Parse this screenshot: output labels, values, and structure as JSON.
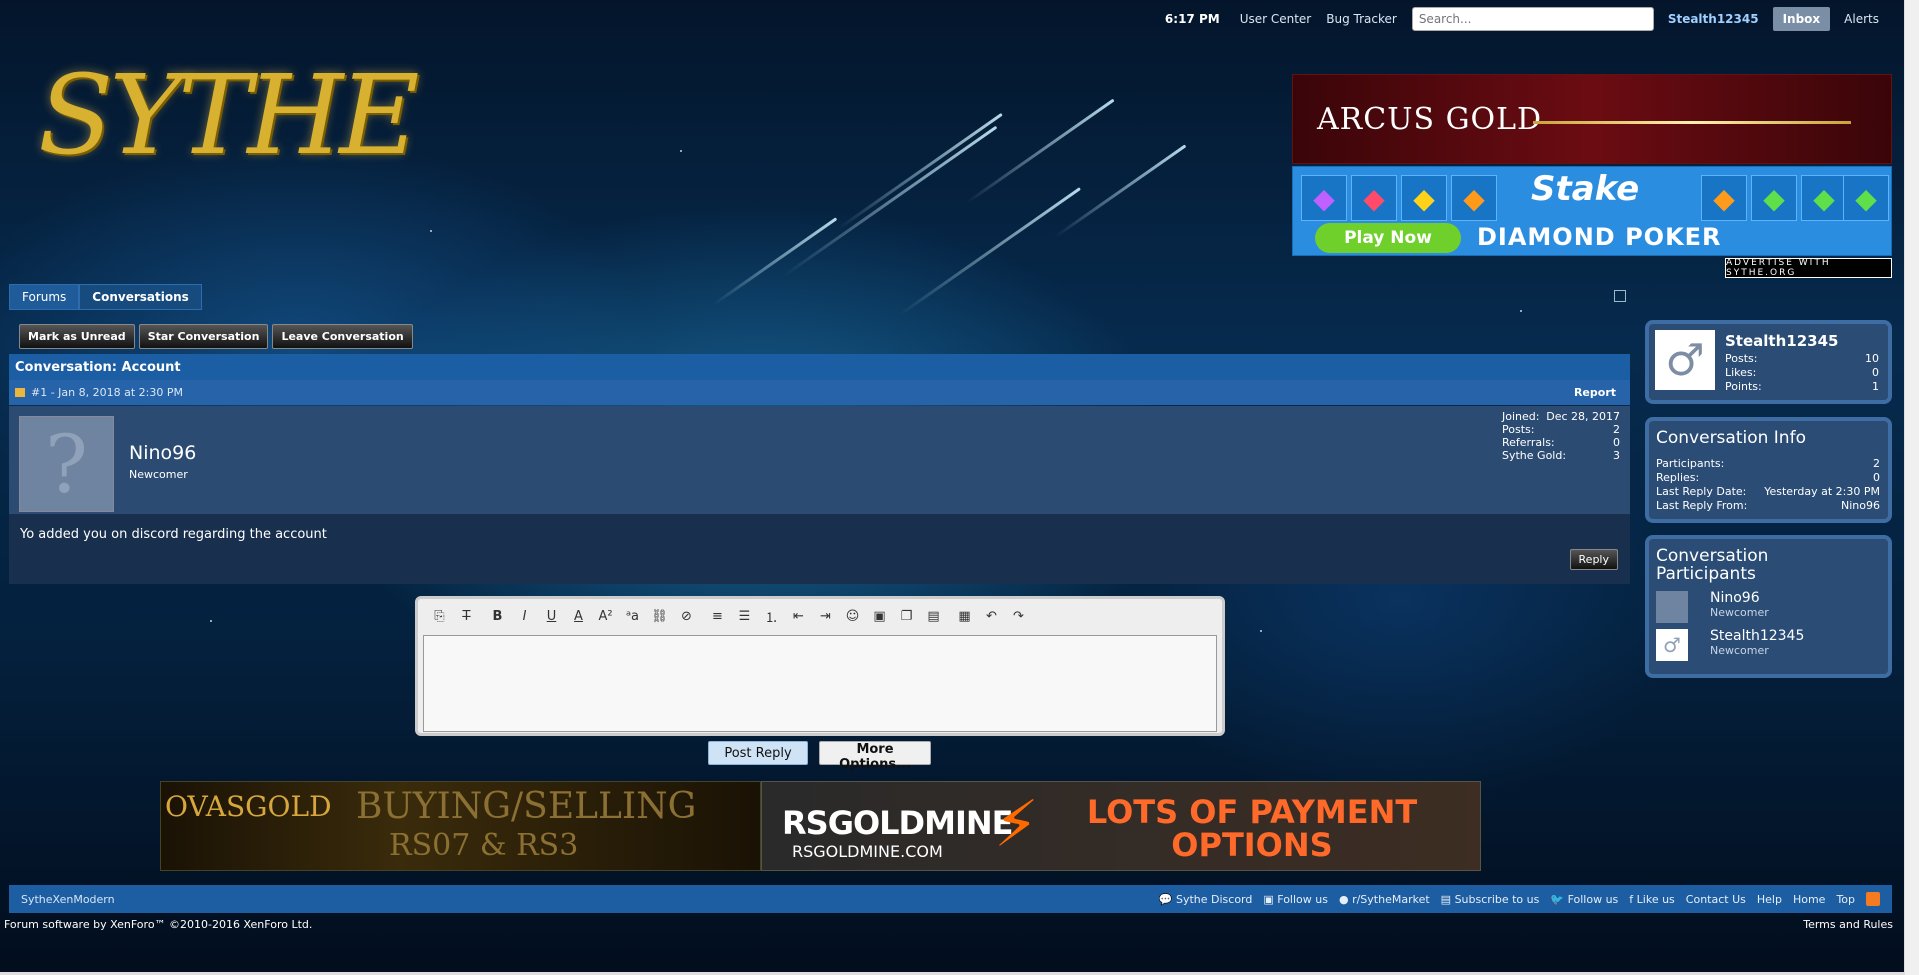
{
  "topbar": {
    "time": "6:17 PM",
    "user_center": "User Center",
    "bug_tracker": "Bug Tracker",
    "search_placeholder": "Search...",
    "username": "Stealth12345",
    "inbox": "Inbox",
    "alerts": "Alerts"
  },
  "logo": "SYTHE",
  "ads": {
    "arcus": "ARCUS GOLD",
    "stake_brand": "Stake",
    "stake_play": "Play Now",
    "stake_poker": "DIAMOND POKER",
    "advertise": "ADVERTISE WITH SYTHE.ORG",
    "ovas_brand": "OVASGOLD",
    "ovas_line1": "BUYING/SELLING",
    "ovas_line2": "RS07 & RS3",
    "rsg_brand": "RSGOLDMINE",
    "rsg_url": "RSGOLDMINE.COM",
    "rsg_tagline": "LOTS OF PAYMENT OPTIONS"
  },
  "breadcrumb": [
    "Forums",
    "Conversations"
  ],
  "actions": {
    "mark_unread": "Mark as Unread",
    "star": "Star Conversation",
    "leave": "Leave Conversation"
  },
  "conversation": {
    "title": "Conversation: Account",
    "meta": "#1 - Jan 8, 2018 at 2:30 PM",
    "report": "Report",
    "author": "Nino96",
    "author_title": "Newcomer",
    "stats": [
      {
        "label": "Joined:",
        "value": "Dec 28, 2017"
      },
      {
        "label": "Posts:",
        "value": "2"
      },
      {
        "label": "Referrals:",
        "value": "0"
      },
      {
        "label": "Sythe Gold:",
        "value": "3"
      }
    ],
    "message": "Yo added you on discord regarding the account",
    "reply": "Reply"
  },
  "editor": {
    "post_reply": "Post Reply",
    "more_options": "More Options..."
  },
  "sidebar": {
    "user": {
      "name": "Stealth12345",
      "stats": [
        {
          "label": "Posts:",
          "value": "10"
        },
        {
          "label": "Likes:",
          "value": "0"
        },
        {
          "label": "Points:",
          "value": "1"
        }
      ]
    },
    "info": {
      "title": "Conversation Info",
      "rows": [
        {
          "label": "Participants:",
          "value": "2"
        },
        {
          "label": "Replies:",
          "value": "0"
        },
        {
          "label": "Last Reply Date:",
          "value": "Yesterday at 2:30 PM"
        },
        {
          "label": "Last Reply From:",
          "value": "Nino96"
        }
      ]
    },
    "participants": {
      "title": "Conversation Participants",
      "list": [
        {
          "name": "Nino96",
          "title": "Newcomer"
        },
        {
          "name": "Stealth12345",
          "title": "Newcomer"
        }
      ]
    }
  },
  "footer": {
    "style": "SytheXenModern",
    "links": [
      "Sythe Discord",
      "Follow us",
      "r/SytheMarket",
      "Subscribe to us",
      "Follow us",
      "Like us",
      "Contact Us",
      "Help",
      "Home",
      "Top"
    ],
    "copyright": "Forum software by XenForo™ ©2010-2016 XenForo Ltd.",
    "terms": "Terms and Rules"
  }
}
